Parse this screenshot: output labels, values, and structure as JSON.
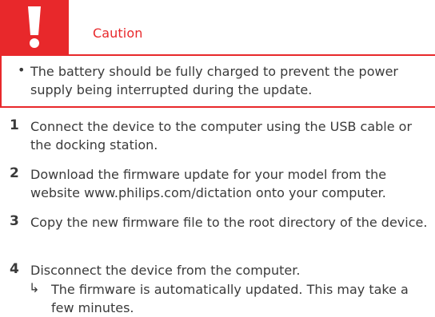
{
  "caution": {
    "title": "Caution",
    "icon": "exclamation-icon",
    "bullet_symbol": "•",
    "text": "The battery should be fully charged to prevent the power supply being interrupted during the update."
  },
  "steps": [
    {
      "number": "1",
      "text": "Connect the device to the computer using the USB cable or the docking station."
    },
    {
      "number": "2",
      "text": "Download the firmware update for your model from the website www.philips.com/dictation onto your computer."
    },
    {
      "number": "3",
      "text": "Copy the new firmware file to the root directory of the device."
    },
    {
      "number": "4",
      "text": "Disconnect the device from the computer.",
      "result_symbol": "↳",
      "result": "The firmware is automatically updated. This may take a few minutes."
    }
  ],
  "colors": {
    "accent": "#e8282b",
    "text": "#3a3a3a"
  }
}
